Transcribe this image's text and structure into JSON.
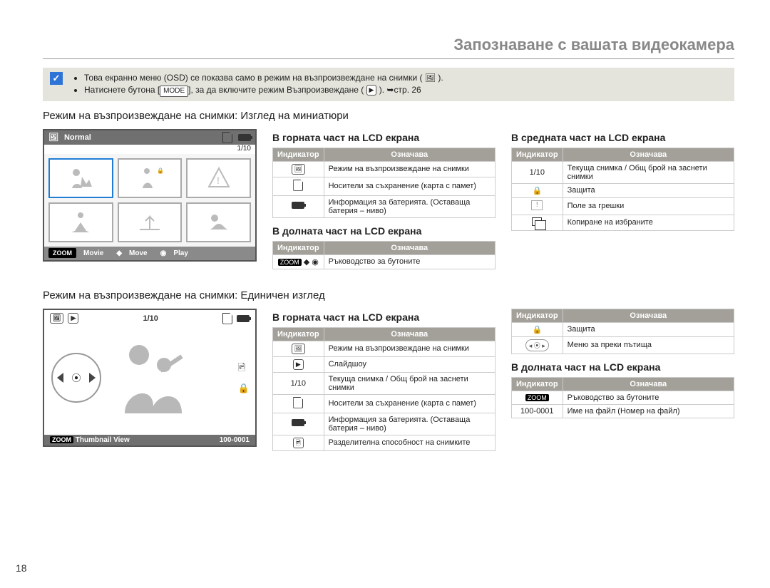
{
  "pageTitle": "Запознаване с вашата видеокамера",
  "pageNumber": "18",
  "info": {
    "bullets": [
      "Това екранно меню (OSD) се показва само в режим на възпроизвеждане на снимки ( 🖼 ).",
      "Натиснете бутона [MODE], за да включите режим Възпроизвеждане ( ▶ ). ➥стр. 26"
    ],
    "modeBtn": "MODE"
  },
  "sectionA": {
    "title": "Режим на възпроизвеждане на снимки: Изглед на миниатюри",
    "lcd": {
      "topLabel": "Normal",
      "count": "1/10",
      "footMovie": "Movie",
      "footMove": "Move",
      "footPlay": "Play",
      "zoom": "ZOOM"
    },
    "topLeft": {
      "heading": "В горната част на LCD екрана",
      "th1": "Индикатор",
      "th2": "Означава",
      "rows": [
        {
          "ic": "photo-mode-icon",
          "txt": "Режим на възпроизвеждане на снимки"
        },
        {
          "ic": "sd-icon",
          "txt": "Носители за съхранение (карта с памет)"
        },
        {
          "ic": "battery-icon",
          "txt": "Информация за батерията. (Оставаща батерия – ниво)"
        }
      ]
    },
    "bottomLeft": {
      "heading": "В долната част на LCD екрана",
      "th1": "Индикатор",
      "th2": "Означава",
      "rows": [
        {
          "ic": "button-guide-icon",
          "txt": "Ръководство за бутоните"
        }
      ]
    },
    "right": {
      "heading": "В средната част на LCD екрана",
      "th1": "Индикатор",
      "th2": "Означава",
      "rows": [
        {
          "ic": "1/10",
          "txt": "Текуща снимка / Общ брой на заснети снимки"
        },
        {
          "ic": "lock-icon",
          "txt": "Защита"
        },
        {
          "ic": "warn-icon",
          "txt": "Поле за грешки"
        },
        {
          "ic": "copy-icon",
          "txt": "Копиране на избраните"
        }
      ]
    }
  },
  "sectionB": {
    "title": "Режим на възпроизвеждане на снимки: Единичен изглед",
    "lcd": {
      "count": "1/10",
      "footLabel": "Thumbnail View",
      "footFile": "100-0001",
      "zoom": "ZOOM"
    },
    "topLeft": {
      "heading": "В горната част на LCD екрана",
      "th1": "Индикатор",
      "th2": "Означава",
      "rows": [
        {
          "ic": "photo-mode-icon",
          "txt": "Режим на възпроизвеждане на снимки"
        },
        {
          "ic": "slideshow-icon",
          "txt": "Слайдшоу"
        },
        {
          "ic": "1/10",
          "txt": "Текуща снимка / Общ брой на заснети снимки"
        },
        {
          "ic": "sd-icon",
          "txt": "Носители за съхранение (карта с памет)"
        },
        {
          "ic": "battery-icon",
          "txt": "Информация за батерията. (Оставаща батерия – ниво)"
        },
        {
          "ic": "resolution-icon",
          "txt": "Разделителна способност на снимките"
        }
      ]
    },
    "rightTop": {
      "th1": "Индикатор",
      "th2": "Означава",
      "rows": [
        {
          "ic": "lock-icon",
          "txt": "Защита"
        },
        {
          "ic": "nav-icon",
          "txt": "Меню за преки пътища"
        }
      ]
    },
    "rightBottom": {
      "heading": "В долната част на LCD екрана",
      "th1": "Индикатор",
      "th2": "Означава",
      "rows": [
        {
          "ic": "zoom-icon",
          "txt": "Ръководство за бутоните"
        },
        {
          "ic": "100-0001",
          "txt": "Име на файл (Номер на файл)"
        }
      ]
    }
  }
}
